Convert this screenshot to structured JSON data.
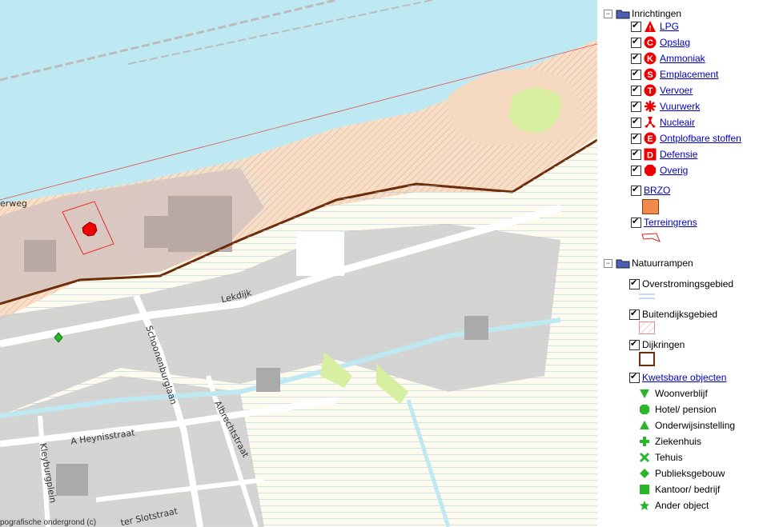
{
  "map": {
    "streets": [
      "erweg",
      "Lekdijk",
      "Schoonenburglaan",
      "Albrechtstraat",
      "A Heynisstraat",
      "Kleyburgplein",
      "ter Slotstraat"
    ],
    "copyright": "pografische ondergrond (c)",
    "colors": {
      "water": "#bfe9f2",
      "land": "#ffffff",
      "built": "#c9c9c9",
      "dike": "#6b2d0a",
      "sand": "#f6dfc5",
      "green": "#d8eea0"
    }
  },
  "legend": {
    "inrichtingen": {
      "label": "Inrichtingen",
      "toggle": "−",
      "items": [
        {
          "label": "LPG",
          "icon": "lpg-triangle-icon"
        },
        {
          "label": "Opslag",
          "icon": "opslag-c-icon"
        },
        {
          "label": "Ammoniak",
          "icon": "ammoniak-k-icon"
        },
        {
          "label": "Emplacement",
          "icon": "emplacement-s-icon"
        },
        {
          "label": "Vervoer",
          "icon": "vervoer-t-icon"
        },
        {
          "label": "Vuurwerk",
          "icon": "vuurwerk-icon"
        },
        {
          "label": "Nucleair",
          "icon": "nucleair-icon"
        },
        {
          "label": "Ontplofbare stoffen",
          "icon": "ontplofbare-e-icon"
        },
        {
          "label": "Defensie",
          "icon": "defensie-d-icon"
        },
        {
          "label": "Overig",
          "icon": "overig-octagon-icon"
        }
      ],
      "brzo": "BRZO",
      "terreingrens": "Terreingrens"
    },
    "natuurrampen": {
      "label": "Natuurrampen",
      "toggle": "−",
      "layers": [
        "Overstromingsgebied",
        "Buitendijksgebied",
        "Dijkringen"
      ],
      "kwetsbare": "Kwetsbare objecten",
      "objects": [
        "Woonverblijf",
        "Hotel/ pension",
        "Onderwijsinstelling",
        "Ziekenhuis",
        "Tehuis",
        "Publieksgebouw",
        "Kantoor/ bedrijf",
        "Ander object"
      ]
    }
  }
}
